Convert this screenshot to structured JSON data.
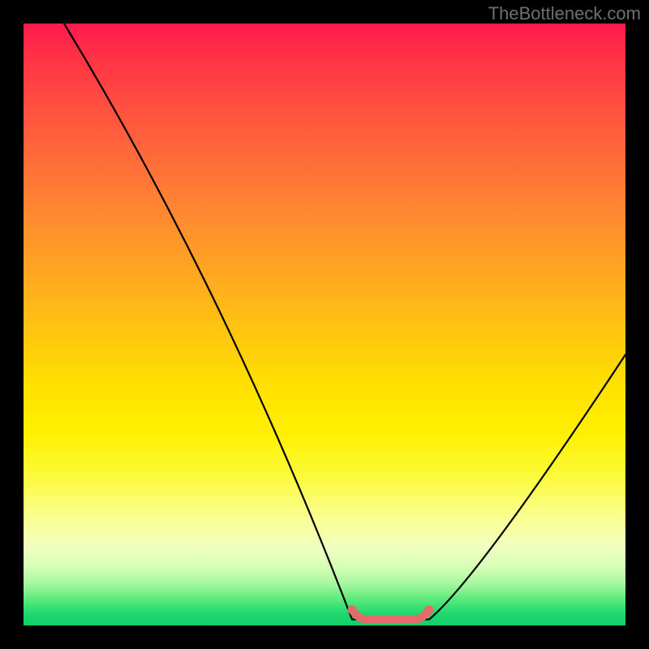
{
  "watermark": {
    "text": "TheBottleneck.com"
  },
  "chart_data": {
    "type": "line",
    "title": "",
    "xlabel": "",
    "ylabel": "",
    "x": [
      50,
      475,
      742
    ],
    "values": [
      100,
      1,
      45
    ],
    "flat_region": {
      "x_start": 405,
      "x_end": 500,
      "y": 1
    },
    "xlim": [
      0,
      742
    ],
    "ylim": [
      0,
      100
    ],
    "grid": false,
    "legend": false,
    "background_gradient": {
      "top": "#ff1a4d",
      "mid": "#ffe000",
      "bottom": "#10cf68"
    },
    "highlight_segment": {
      "color": "#e46b6b",
      "x_start": 405,
      "x_end": 500
    }
  }
}
